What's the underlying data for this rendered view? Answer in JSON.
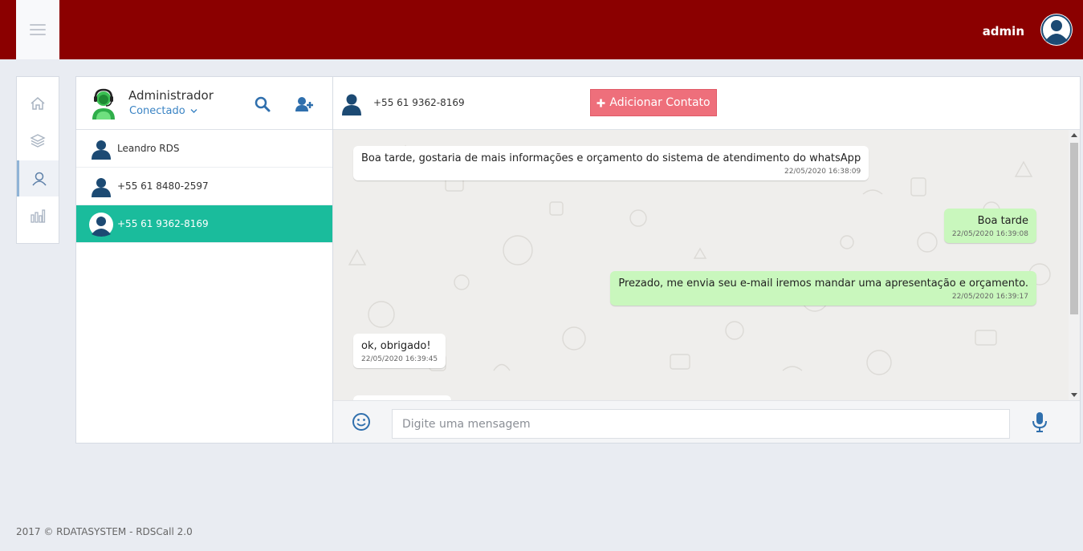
{
  "topbar": {
    "user_name": "admin",
    "brand_color": "#8b0000"
  },
  "leftnav": {
    "items": [
      {
        "icon": "home-icon"
      },
      {
        "icon": "layers-icon"
      },
      {
        "icon": "user-icon",
        "active": true
      },
      {
        "icon": "bar-chart-icon"
      }
    ]
  },
  "contacts": {
    "me": {
      "name": "Administrador",
      "status": "Conectado"
    },
    "list": [
      {
        "name": "Leandro RDS"
      },
      {
        "name": "+55 61 8480-2597"
      },
      {
        "name": "+55 61 9362-8169",
        "selected": true
      }
    ],
    "selected_color": "#1abc9c"
  },
  "chat": {
    "contact_number": "+55 61 9362-8169",
    "add_contact_label": "Adicionar Contato",
    "messages": [
      {
        "direction": "in",
        "text": "Boa tarde, gostaria de mais informações e orçamento do sistema de atendimento do whatsApp",
        "time": "22/05/2020 16:38:09"
      },
      {
        "direction": "out",
        "text": "Boa tarde",
        "time": "22/05/2020 16:39:08"
      },
      {
        "direction": "out",
        "text": "Prezado, me envia seu e-mail iremos mandar uma apresentação e orçamento.",
        "time": "22/05/2020 16:39:17"
      },
      {
        "direction": "in",
        "text": "ok, obrigado!",
        "time": "22/05/2020 16:39:45"
      }
    ],
    "input_placeholder": "Digite uma mensagem"
  },
  "footer": {
    "text": "2017 © RDATASYSTEM - RDSCall 2.0"
  }
}
